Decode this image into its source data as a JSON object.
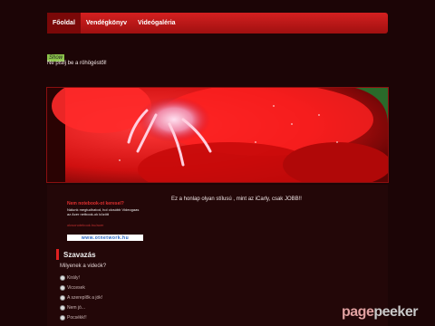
{
  "nav": {
    "items": [
      {
        "label": "Főoldal",
        "active": true
      },
      {
        "label": "Vendégkönyv",
        "active": false
      },
      {
        "label": "Videógaléria",
        "active": false
      }
    ]
  },
  "intro": {
    "badge": "Show",
    "text": "Ne pisilj be a röhögéstől!"
  },
  "banner": {
    "image": "red-flower-photo"
  },
  "sidebar": {
    "ad": {
      "title": "Nem notebook-ot keresel?",
      "text": "Nálunk megtudhatod, hol olcsóbb Videogaas az Acer netbook-ok között",
      "link": "olcsonotebook.hu/acer",
      "banner_label": "www.otnetwork.hu"
    },
    "vote": {
      "title": "Szavazás",
      "question": "Milyenek a videók?",
      "options": [
        "Király!",
        "Viccesek",
        "A szereplők a jók!",
        "Nem jó...",
        "Pocsékk!!"
      ]
    }
  },
  "main": {
    "text": "Ez a honlap olyan stílusú , mint az iCarly, csak JOBB!!"
  },
  "watermark": {
    "part1": "page",
    "part2": "peeker"
  }
}
